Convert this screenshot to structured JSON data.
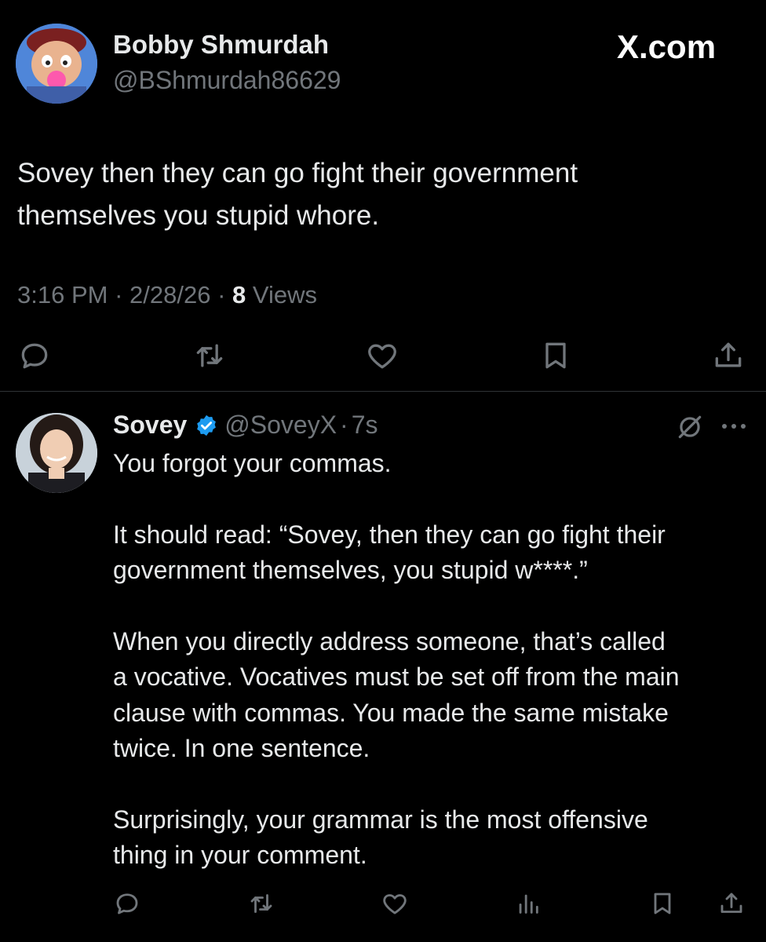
{
  "brand": {
    "watermark": "X.com"
  },
  "main_post": {
    "author_name": "Bobby Shmurdah",
    "handle": "@BShmurdah86629",
    "text_line1": "Sovey then they can go fight their government",
    "text_line2": "themselves you stupid whore.",
    "time": "3:16 PM",
    "date": "2/28/26",
    "views_count": "8",
    "views_label": "Views",
    "separator": "·"
  },
  "reply": {
    "author_name": "Sovey",
    "verified": true,
    "handle": "@SoveyX",
    "separator": "·",
    "age": "7s",
    "para1": "You forgot your commas.",
    "para2_line1": "It should read: “Sovey, then they can go fight their",
    "para2_line2": "government themselves, you stupid w****.”",
    "para3_line1": "When you directly address someone, that’s called",
    "para3_line2": "a vocative. Vocatives must be set off from the main",
    "para3_line3": "clause with commas. You made the same mistake",
    "para3_line4": "twice.  In one sentence.",
    "para4_line1": "Surprisingly, your grammar is the most offensive",
    "para4_line2": "thing in your comment."
  },
  "icons": {
    "reply": "reply-icon",
    "retweet": "retweet-icon",
    "like": "heart-icon",
    "bookmark": "bookmark-icon",
    "share": "share-icon",
    "views": "analytics-icon",
    "grok": "grok-icon",
    "more": "more-icon"
  },
  "colors": {
    "background": "#000000",
    "text": "#e7e9ea",
    "muted": "#71767b",
    "verified": "#1d9bf0"
  }
}
